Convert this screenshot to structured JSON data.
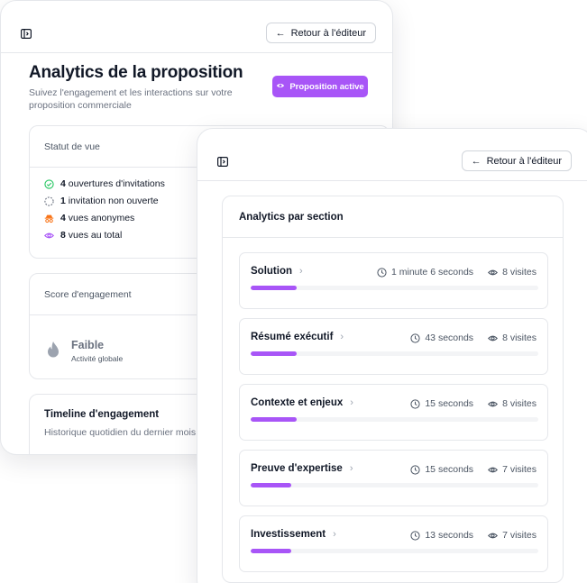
{
  "back_window": {
    "back_button_label": "Retour à l'éditeur",
    "title": "Analytics de la proposition",
    "subtitle": "Suivez l'engagement et les interactions sur votre proposition commerciale",
    "active_button_label": "Proposition active",
    "status_card": {
      "header": "Statut de vue",
      "rows": [
        {
          "count": "4",
          "label": "ouvertures d'invitations",
          "icon": "check-circle-icon",
          "color": "#22c55e"
        },
        {
          "count": "1",
          "label": "invitation non ouverte",
          "icon": "dashed-circle-icon",
          "color": "#6b7280"
        },
        {
          "count": "4",
          "label": "vues anonymes",
          "icon": "incognito-icon",
          "color": "#f97316"
        },
        {
          "count": "8",
          "label": "vues au total",
          "icon": "eye-icon",
          "color": "#a855f7"
        }
      ]
    },
    "score_card": {
      "header": "Score d'engagement",
      "level": "Faible",
      "caption": "Activité globale",
      "icon": "flame-icon"
    },
    "timeline_card": {
      "title": "Timeline d'engagement",
      "subtitle": "Historique quotidien du dernier mois"
    }
  },
  "front_window": {
    "back_button_label": "Retour à l'éditeur",
    "panel_title": "Analytics par section",
    "sections": [
      {
        "name": "Solution",
        "duration": "1 minute 6 seconds",
        "visits": "8 visites",
        "progress": 0.16
      },
      {
        "name": "Résumé exécutif",
        "duration": "43 seconds",
        "visits": "8 visites",
        "progress": 0.16
      },
      {
        "name": "Contexte et enjeux",
        "duration": "15 seconds",
        "visits": "8 visites",
        "progress": 0.16
      },
      {
        "name": "Preuve d'expertise",
        "duration": "15 seconds",
        "visits": "7 visites",
        "progress": 0.14
      },
      {
        "name": "Investissement",
        "duration": "13 seconds",
        "visits": "7 visites",
        "progress": 0.14
      }
    ]
  },
  "colors": {
    "accent": "#a855f7",
    "border": "#e5e7eb",
    "muted_text": "#6b7280"
  }
}
